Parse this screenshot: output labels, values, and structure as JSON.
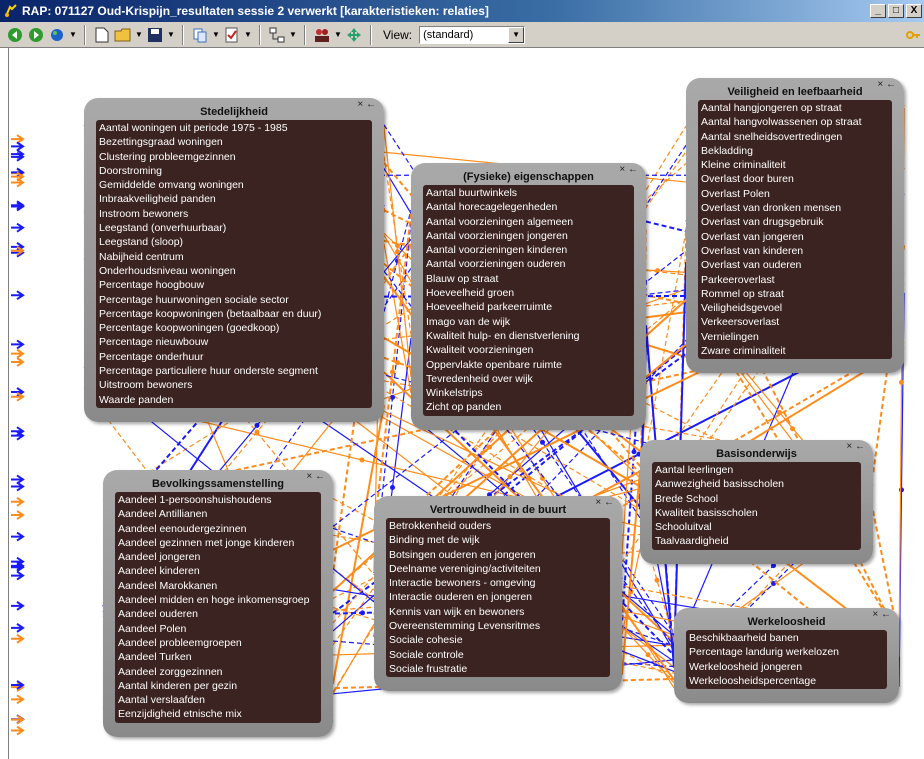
{
  "window": {
    "title": "RAP: 071127 Oud-Krispijn_resultaten sessie 2 verwerkt [karakteristieken: relaties]",
    "minimize": "_",
    "maximize": "□",
    "close": "X"
  },
  "toolbar": {
    "view_label": "View:",
    "view_value": "(standard)"
  },
  "colors": {
    "node_bg": "#3a2320",
    "line_orange": "#ff8c1a",
    "line_blue": "#1a1aff"
  },
  "nodes": [
    {
      "title": "Stedelijkheid",
      "items": [
        "Aantal woningen uit periode 1975 - 1985",
        "Bezettingsgraad woningen",
        "Clustering probleemgezinnen",
        "Doorstroming",
        "Gemiddelde omvang woningen",
        "Inbraakveiligheid panden",
        "Instroom bewoners",
        "Leegstand (onverhuurbaar)",
        "Leegstand (sloop)",
        "Nabijheid centrum",
        "Onderhoudsniveau woningen",
        "Percentage hoogbouw",
        "Percentage huurwoningen sociale sector",
        "Percentage koopwoningen (betaalbaar en duur)",
        "Percentage koopwoningen (goedkoop)",
        "Percentage nieuwbouw",
        "Percentage onderhuur",
        "Percentage particuliere huur onderste segment",
        "Uitstroom bewoners",
        "Waarde panden"
      ]
    },
    {
      "title": "(Fysieke) eigenschappen",
      "items": [
        "Aantal buurtwinkels",
        "Aantal horecagelegenheden",
        "Aantal voorzieningen algemeen",
        "Aantal voorzieningen jongeren",
        "Aantal voorzieningen kinderen",
        "Aantal voorzieningen ouderen",
        "Blauw op straat",
        "Hoeveelheid groen",
        "Hoeveelheid parkeerruimte",
        "Imago van de wijk",
        "Kwaliteit hulp- en dienstverlening",
        "Kwaliteit voorzieningen",
        "Oppervlakte openbare ruimte",
        "Tevredenheid over wijk",
        "Winkelstrips",
        "Zicht op panden"
      ]
    },
    {
      "title": "Veiligheid en leefbaarheid",
      "items": [
        "Aantal hangjongeren op straat",
        "Aantal hangvolwassenen op straat",
        "Aantal snelheidsovertredingen",
        "Bekladding",
        "Kleine criminaliteit",
        "Overlast door buren",
        "Overlast Polen",
        "Overlast van dronken mensen",
        "Overlast van drugsgebruik",
        "Overlast van jongeren",
        "Overlast van kinderen",
        "Overlast van ouderen",
        "Parkeeroverlast",
        "Rommel op straat",
        "Veiligheidsgevoel",
        "Verkeersoverlast",
        "Vernielingen",
        "Zware criminaliteit"
      ]
    },
    {
      "title": "Bevolkingssamenstelling",
      "items": [
        "Aandeel 1-persoonshuishoudens",
        "Aandeel Antillianen",
        "Aandeel eenoudergezinnen",
        "Aandeel gezinnen met jonge kinderen",
        "Aandeel jongeren",
        "Aandeel kinderen",
        "Aandeel Marokkanen",
        "Aandeel midden en hoge inkomensgroep",
        "Aandeel ouderen",
        "Aandeel Polen",
        "Aandeel probleemgroepen",
        "Aandeel Turken",
        "Aandeel zorggezinnen",
        "Aantal kinderen per gezin",
        "Aantal verslaafden",
        "Eenzijdigheid etnische mix"
      ]
    },
    {
      "title": "Vertrouwdheid in de buurt",
      "items": [
        "Betrokkenheid ouders",
        "Binding met de wijk",
        "Botsingen ouderen en jongeren",
        "Deelname vereniging/activiteiten",
        "Interactie bewoners - omgeving",
        "Interactie ouderen en jongeren",
        "Kennis van wijk en bewoners",
        "Overeenstemming Levensritmes",
        "Sociale cohesie",
        "Sociale controle",
        "Sociale frustratie"
      ]
    },
    {
      "title": "Basisonderwijs",
      "items": [
        "Aantal leerlingen",
        "Aanwezigheid basisscholen",
        "Brede School",
        "Kwaliteit basisscholen",
        "Schooluitval",
        "Taalvaardigheid"
      ]
    },
    {
      "title": "Werkeloosheid",
      "items": [
        "Beschikbaarheid banen",
        "Percentage landurig werkelozen",
        "Werkeloosheid jongeren",
        "Werkeloosheidspercentage"
      ]
    }
  ]
}
